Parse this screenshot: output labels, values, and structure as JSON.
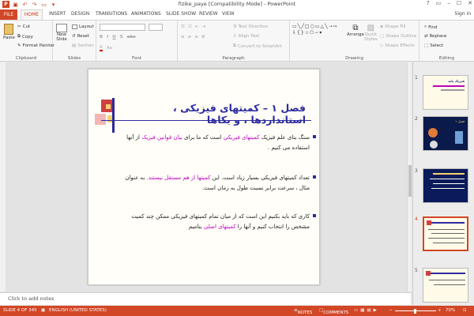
{
  "window": {
    "title": "fizike_paye [Compatibility Mode] - PowerPoint",
    "controls": [
      "?",
      "▭",
      "–",
      "☐",
      "✕"
    ]
  },
  "tabs": [
    "FILE",
    "HOME",
    "INSERT",
    "DESIGN",
    "TRANSITIONS",
    "ANIMATIONS",
    "SLIDE SHOW",
    "REVIEW",
    "VIEW"
  ],
  "signin": "Sign in",
  "ribbon": {
    "clipboard": {
      "label": "Clipboard",
      "paste": "Paste",
      "cut": "Cut",
      "copy": "Copy",
      "format_painter": "Format Painter"
    },
    "slides": {
      "label": "Slides",
      "new_slide": "New",
      "new_slide2": "Slide",
      "layout": "Layout",
      "reset": "Reset",
      "section": "Section"
    },
    "font": {
      "label": "Font"
    },
    "paragraph": {
      "label": "Paragraph",
      "text_direction": "Text Direction",
      "align_text": "Align Text",
      "convert": "Convert to SmartArt"
    },
    "drawing": {
      "label": "Drawing",
      "arrange": "Arrange",
      "quick_styles": "Quick",
      "quick_styles2": "Styles",
      "shape_fill": "Shape Fill",
      "shape_outline": "Shape Outline",
      "shape_effects": "Shape Effects"
    },
    "editing": {
      "label": "Editing",
      "find": "Find",
      "replace": "Replace",
      "select": "Select"
    }
  },
  "slide": {
    "title": "فصل ۱ – کمیتهای فیزیکی ، استانداردها ، و یکاها",
    "bullets": [
      {
        "parts": [
          {
            "t": "سنگ بنای علم فیزیک "
          },
          {
            "t": "کمیتهای فیزیکی",
            "c": "mg"
          },
          {
            "t": " است که ما برای "
          },
          {
            "t": "بیان قوانین فیزیک",
            "c": "mg"
          },
          {
            "t": " از آنها استفاده می کنیم ."
          }
        ]
      },
      {
        "parts": [
          {
            "t": "تعداد کمیتهای فیزیکی بسیار زیاد است. این "
          },
          {
            "t": "کمیتها از هم مستقل نیستند.",
            "c": "mg"
          },
          {
            "t": " به عنوان مثال ، سرعت برابر نسبت طول به زمان است."
          }
        ]
      },
      {
        "parts": [
          {
            "t": "کاری که باید بکنیم این است که از میان تمام کمیتهای فیزیکی ممکن چند کمیت مشخص را انتخاب کنیم و آنها را "
          },
          {
            "t": "کمیتهای اصلی",
            "c": "mg"
          },
          {
            "t": " بنامیم"
          }
        ]
      }
    ]
  },
  "notes_placeholder": "Click to add notes",
  "thumbnails": [
    {
      "num": "1",
      "title": "فیزیک پایه"
    },
    {
      "num": "2",
      "title": "فصل ۱"
    },
    {
      "num": "3",
      "title": ""
    },
    {
      "num": "4",
      "title": ""
    },
    {
      "num": "5",
      "title": ""
    }
  ],
  "status": {
    "slide": "SLIDE 4 OF 345",
    "language": "ENGLISH (UNITED STATES)",
    "notes": "NOTES",
    "comments": "COMMENTS",
    "zoom": "70%"
  },
  "colors": {
    "accent": "#d24726",
    "title": "#2b2aa0",
    "highlight": "#c000c0"
  }
}
